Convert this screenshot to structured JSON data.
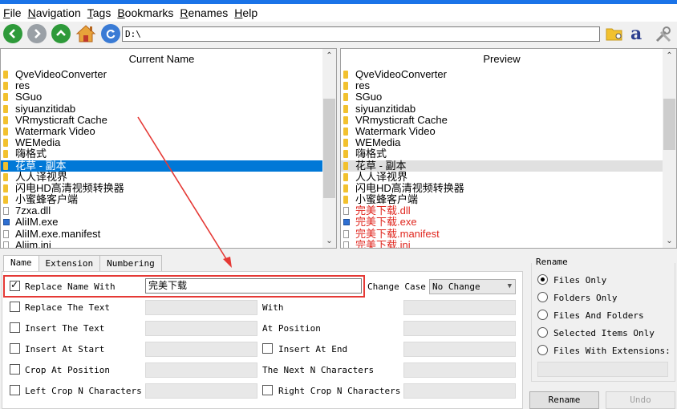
{
  "menu": [
    "File",
    "Navigation",
    "Tags",
    "Bookmarks",
    "Renames",
    "Help"
  ],
  "menu_underline": [
    "F",
    "N",
    "T",
    "B",
    "R",
    "H"
  ],
  "toolbar": {
    "path": "D:\\",
    "btn_colors": {
      "back": "#2e9a3a",
      "forward": "#9aa0a6",
      "up": "#2e9a3a",
      "refresh": "#3a7bd5"
    }
  },
  "current": {
    "header": "Current Name",
    "items": [
      {
        "name": "QveVideoConverter",
        "type": "folder"
      },
      {
        "name": "res",
        "type": "folder"
      },
      {
        "name": "SGuo",
        "type": "folder"
      },
      {
        "name": "siyuanzitidab",
        "type": "folder"
      },
      {
        "name": "VRmysticraft Cache",
        "type": "folder"
      },
      {
        "name": "Watermark Video",
        "type": "folder"
      },
      {
        "name": "WEMedia",
        "type": "folder"
      },
      {
        "name": "嗨格式",
        "type": "folder"
      },
      {
        "name": "花草 - 副本",
        "type": "folder"
      },
      {
        "name": "人人译视界",
        "type": "folder"
      },
      {
        "name": "闪电HD高清视频转换器",
        "type": "folder"
      },
      {
        "name": "小蜜蜂客户端",
        "type": "folder"
      },
      {
        "name": "7zxa.dll",
        "type": "file"
      },
      {
        "name": "AliIM.exe",
        "type": "exe"
      },
      {
        "name": "AliIM.exe.manifest",
        "type": "file"
      },
      {
        "name": "Aliim.ini",
        "type": "file"
      }
    ]
  },
  "preview": {
    "header": "Preview",
    "items": [
      {
        "name": "QveVideoConverter",
        "type": "folder"
      },
      {
        "name": "res",
        "type": "folder"
      },
      {
        "name": "SGuo",
        "type": "folder"
      },
      {
        "name": "siyuanzitidab",
        "type": "folder"
      },
      {
        "name": "VRmysticraft Cache",
        "type": "folder"
      },
      {
        "name": "Watermark Video",
        "type": "folder"
      },
      {
        "name": "WEMedia",
        "type": "folder"
      },
      {
        "name": "嗨格式",
        "type": "folder"
      },
      {
        "name": "花草 - 副本",
        "type": "folder"
      },
      {
        "name": "人人译视界",
        "type": "folder"
      },
      {
        "name": "闪电HD高清视频转换器",
        "type": "folder"
      },
      {
        "name": "小蜜蜂客户端",
        "type": "folder"
      },
      {
        "name": "完美下载.dll",
        "type": "file"
      },
      {
        "name": "完美下载.exe",
        "type": "exe"
      },
      {
        "name": "完美下载.manifest",
        "type": "file"
      },
      {
        "name": "完美下载.ini",
        "type": "file"
      }
    ]
  },
  "tabs": [
    "Name",
    "Extension",
    "Numbering"
  ],
  "options": {
    "replace_name_with": "Replace Name With",
    "replace_value": "完美下载",
    "change_case": "Change Case",
    "change_case_value": "No Change",
    "replace_the_text": "Replace The Text",
    "with": "With",
    "insert_the_text": "Insert The Text",
    "at_position": "At Position",
    "insert_at_start": "Insert At Start",
    "insert_at_end": "Insert At End",
    "crop_at_position": "Crop At Position",
    "next_n_chars": "The Next N Characters",
    "left_crop": "Left Crop N Characters",
    "right_crop": "Right Crop N Characters"
  },
  "rename_group": {
    "title": "Rename",
    "files_only": "Files Only",
    "folders_only": "Folders Only",
    "files_and_folders": "Files And Folders",
    "selected_items_only": "Selected Items Only",
    "files_with_ext": "Files With Extensions:"
  },
  "buttons": {
    "rename": "Rename",
    "undo": "Undo"
  }
}
